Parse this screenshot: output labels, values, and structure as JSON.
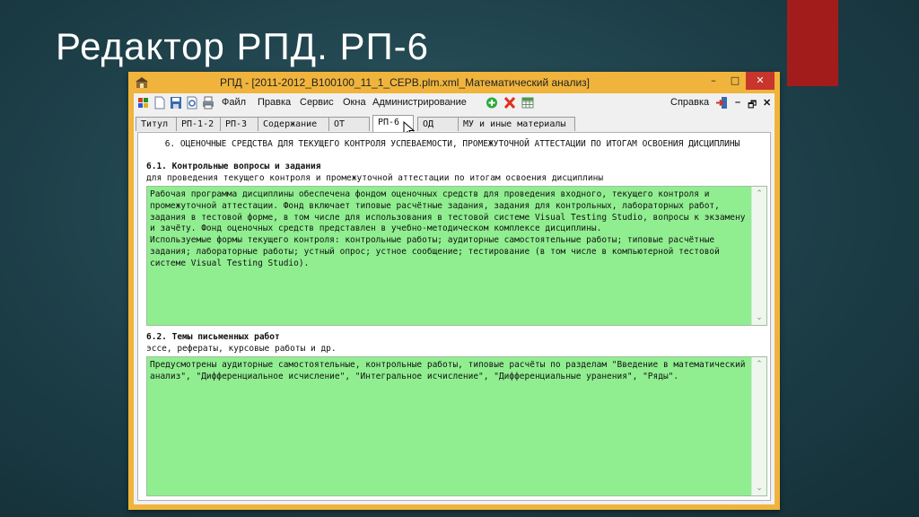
{
  "slide": {
    "title": "Редактор РПД. РП-6"
  },
  "window": {
    "title": "РПД - [2011-2012_B100100_11_1_СЕРВ.plm.xml_Математический анализ]",
    "min_glyph": "–",
    "max_glyph": "□",
    "close_glyph": "✕"
  },
  "menu": {
    "file": "Файл",
    "edit": "Правка",
    "service": "Сервис",
    "windows": "Окна",
    "admin": "Администрирование",
    "help": "Справка",
    "mdi_min": "–",
    "mdi_restore": "🗗",
    "mdi_close": "✕"
  },
  "tabs": [
    "Титул",
    "РП-1-2",
    "РП-3",
    "Содержание",
    "ОТ",
    "РП-6",
    "ОД",
    "МУ и иные материалы"
  ],
  "section": {
    "heading": "6. ОЦЕНОЧНЫЕ СРЕДСТВА ДЛЯ ТЕКУЩЕГО КОНТРОЛЯ УСПЕВАЕМОСТИ, ПРОМЕЖУТОЧНОЙ АТТЕСТАЦИИ ПО ИТОГАМ ОСВОЕНИЯ ДИСЦИПЛИНЫ",
    "s1_title": "6.1. Контрольные вопросы и задания",
    "s1_sub": "для проведения текущего контроля и промежуточной аттестации по итогам освоения дисциплины",
    "s1_text": "Рабочая программа дисциплины обеспечена фондом оценочных средств для проведения входного, текущего контроля и промежуточной аттестации. Фонд включает типовые расчётные задания, задания для контрольных, лабораторных работ, задания в тестовой форме, в том числе для использования в тестовой системе Visual Testing Studio, вопросы к экзамену и зачёту. Фонд оценочных средств представлен в учебно-методическом комплексе дисциплины.\nИспользуемые формы текущего контроля: контрольные работы; аудиторные самостоятельные работы; типовые расчётные задания; лабораторные работы; устный опрос; устное сообщение; тестирование (в том числе в компьютерной тестовой системе Visual Testing Studio).",
    "s2_title": "6.2. Темы письменных работ",
    "s2_sub": "эссе, рефераты, курсовые работы и др.",
    "s2_text": "Предусмотрены аудиторные самостоятельные, контрольные работы, типовые расчёты по разделам \"Введение в математический анализ\", \"Дифференциальное исчисление\", \"Интегральное исчисление\", \"Дифференциальные уранения\", \"Ряды\"."
  },
  "colors": {
    "accent": "#a31c1c",
    "window_frame": "#f0b43c",
    "field_bg": "#90ee90"
  }
}
